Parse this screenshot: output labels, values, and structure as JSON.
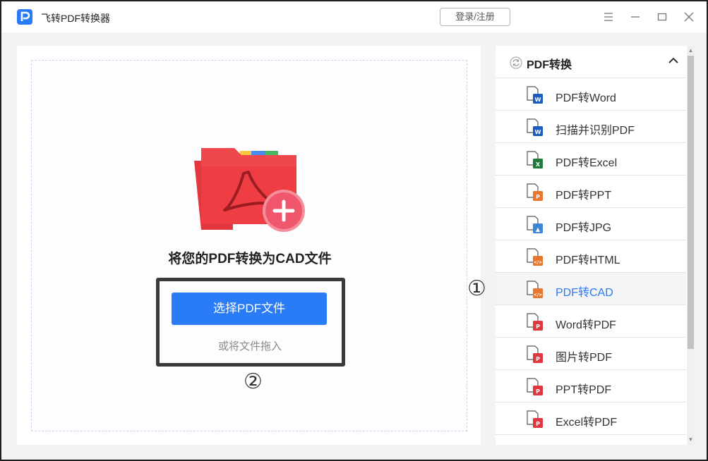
{
  "app": {
    "title": "飞转PDF转换器",
    "login_label": "登录/注册",
    "accent": "#2a7bf6"
  },
  "window_controls": [
    "menu-icon",
    "minimize-icon",
    "maximize-icon",
    "close-icon"
  ],
  "main": {
    "heading": "将您的PDF转换为CAD文件",
    "select_button": "选择PDF文件",
    "drag_hint": "或将文件拖入"
  },
  "annotations": {
    "marker_1": "①",
    "marker_2": "②"
  },
  "sidebar": {
    "section_title": "PDF转换",
    "items": [
      {
        "label": "PDF转Word",
        "icon": "word-file-icon",
        "color": "#1e5bbf",
        "glyph": "W"
      },
      {
        "label": "扫描并识别PDF",
        "icon": "ocr-file-icon",
        "color": "#1e5bbf",
        "glyph": "W"
      },
      {
        "label": "PDF转Excel",
        "icon": "excel-file-icon",
        "color": "#1e7a3c",
        "glyph": "X"
      },
      {
        "label": "PDF转PPT",
        "icon": "ppt-file-icon",
        "color": "#e8762d",
        "glyph": "P"
      },
      {
        "label": "PDF转JPG",
        "icon": "image-file-icon",
        "color": "#3e86d8",
        "glyph": "▲"
      },
      {
        "label": "PDF转HTML",
        "icon": "html-file-icon",
        "color": "#e8762d",
        "glyph": "</>"
      },
      {
        "label": "PDF转CAD",
        "icon": "cad-file-icon",
        "color": "#e8762d",
        "glyph": "</>",
        "active": true
      },
      {
        "label": "Word转PDF",
        "icon": "pdf-file-icon",
        "color": "#e0383e",
        "glyph": "P"
      },
      {
        "label": "图片转PDF",
        "icon": "pdf-file-icon",
        "color": "#e0383e",
        "glyph": "P"
      },
      {
        "label": "PPT转PDF",
        "icon": "pdf-file-icon",
        "color": "#e0383e",
        "glyph": "P"
      },
      {
        "label": "Excel转PDF",
        "icon": "pdf-file-icon",
        "color": "#e0383e",
        "glyph": "P"
      }
    ]
  }
}
